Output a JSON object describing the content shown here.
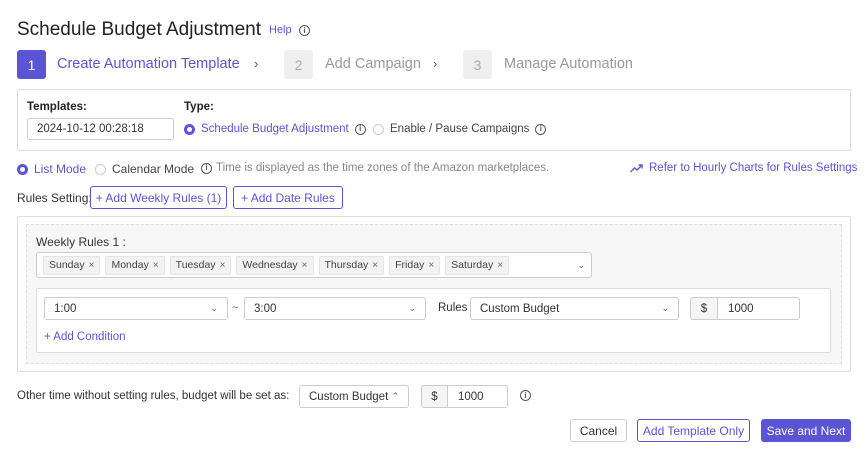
{
  "header": {
    "title": "Schedule Budget Adjustment",
    "help": "Help"
  },
  "steps": [
    {
      "num": "1",
      "label": "Create Automation Template"
    },
    {
      "num": "2",
      "label": "Add Campaign"
    },
    {
      "num": "3",
      "label": "Manage Automation"
    }
  ],
  "template": {
    "templates_label": "Templates:",
    "templates_value": "2024-10-12 00:28:18",
    "type_label": "Type:",
    "type_options": [
      "Schedule Budget Adjustment",
      "Enable / Pause Campaigns"
    ]
  },
  "mode": {
    "list_mode": "List Mode",
    "calendar_mode": "Calendar Mode",
    "note": "Time is displayed as the time zones of the Amazon marketplaces.",
    "hourly_link": "Refer to Hourly Charts for Rules Settings"
  },
  "rules_setting": {
    "label": "Rules Setting:",
    "add_weekly": "+ Add Weekly Rules (1)",
    "add_date": "+ Add Date Rules"
  },
  "weekly_rule": {
    "title": "Weekly Rules 1 :",
    "days": [
      "Sunday",
      "Monday",
      "Tuesday",
      "Wednesday",
      "Thursday",
      "Friday",
      "Saturday"
    ],
    "start_time": "1:00",
    "separator": "~",
    "end_time": "3:00",
    "rules_label": "Rules",
    "rule_type": "Custom Budget",
    "currency": "$",
    "amount": "1000",
    "add_condition": "+ Add Condition"
  },
  "other_time": {
    "label": "Other time without setting rules, budget will be set as:",
    "budget_type": "Custom Budget",
    "currency": "$",
    "amount": "1000"
  },
  "footer": {
    "cancel": "Cancel",
    "add_template_only": "Add Template Only",
    "save_and_next": "Save and Next"
  },
  "colors": {
    "accent": "#5b55d6"
  }
}
